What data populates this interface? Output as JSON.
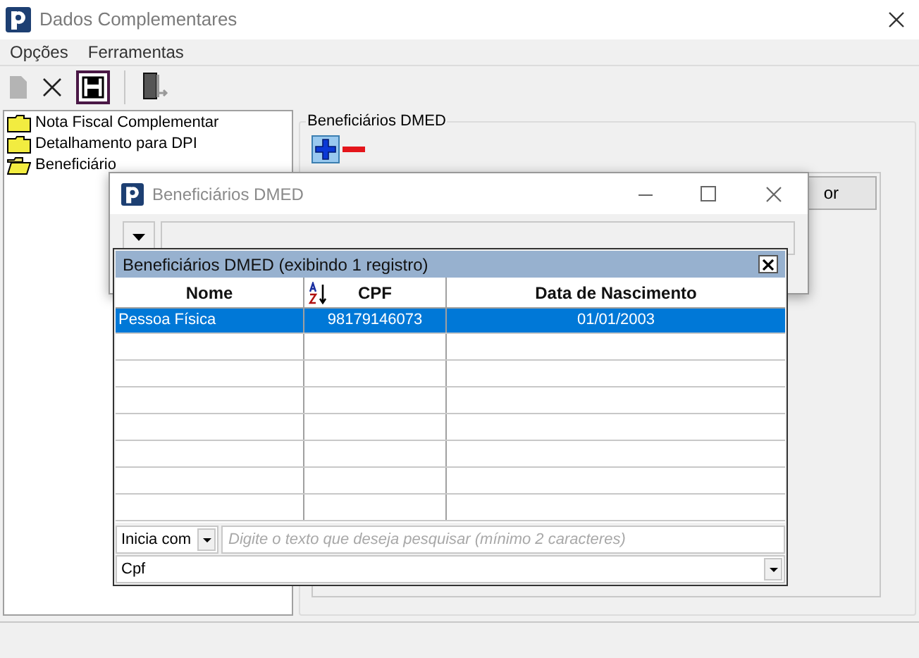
{
  "window": {
    "title": "Dados Complementares"
  },
  "menu": [
    {
      "label": "Opções"
    },
    {
      "label": "Ferramentas"
    }
  ],
  "tree": [
    {
      "label": "Nota Fiscal Complementar",
      "open": false
    },
    {
      "label": "Detalhamento para DPI",
      "open": false
    },
    {
      "label": "Beneficiário",
      "open": true
    }
  ],
  "group": {
    "title": "Beneficiários DMED",
    "button_label": "or"
  },
  "dialog": {
    "title": "Beneficiários DMED"
  },
  "grid": {
    "title": "Beneficiários DMED (exibindo 1 registro)",
    "columns": [
      {
        "label": "Nome",
        "sorted": false
      },
      {
        "label": "CPF",
        "sorted": true
      },
      {
        "label": "Data de Nascimento",
        "sorted": false
      }
    ],
    "rows": [
      {
        "cells": [
          "Pessoa Física",
          "98179146073",
          "01/01/2003"
        ],
        "selected": true
      }
    ],
    "filter": {
      "mode": "Inicia com",
      "placeholder": "Digite o texto que deseja pesquisar (mínimo 2 caracteres)",
      "field": "Cpf"
    }
  }
}
